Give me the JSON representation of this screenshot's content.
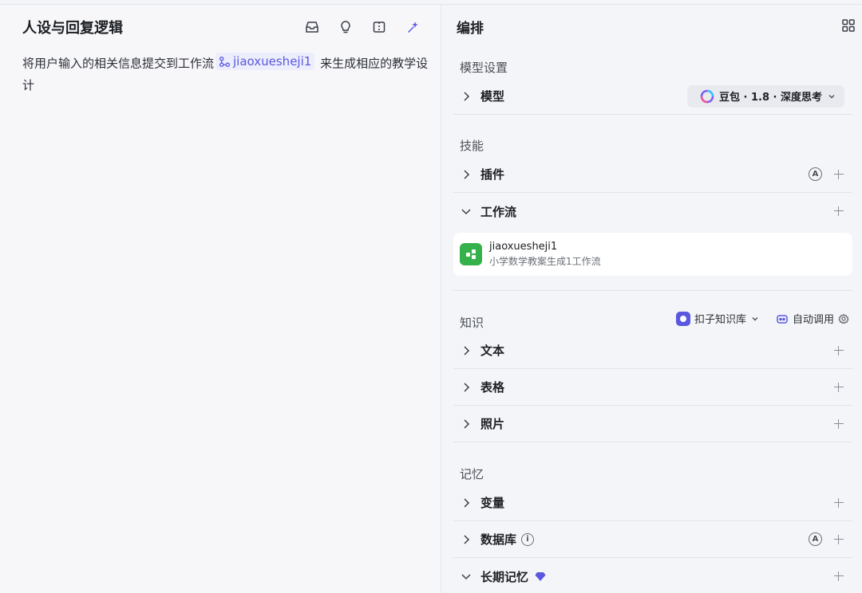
{
  "left": {
    "title": "人设与回复逻辑",
    "prompt_before": "将用户输入的相关信息提交到工作流",
    "workflow_ref": "jiaoxuesheji1",
    "prompt_after": " 来生成相应的教学设计"
  },
  "right": {
    "title": "编排",
    "model_section": "模型设置",
    "model_label": "模型",
    "model_value": "豆包 · 1.8 · 深度思考",
    "skills_section": "技能",
    "plugin_label": "插件",
    "workflow_label": "工作流",
    "workflow_card": {
      "name": "jiaoxuesheji1",
      "desc": "小学数学教案生成1工作流"
    },
    "knowledge_section": "知识",
    "kb_source": "扣子知识库",
    "kb_mode": "自动调用",
    "text_label": "文本",
    "table_label": "表格",
    "photo_label": "照片",
    "memory_section": "记忆",
    "variable_label": "变量",
    "database_label": "数据库",
    "longterm_label": "长期记忆"
  },
  "colors": {
    "accent": "#5a57e0",
    "workflow_green": "#34b14b",
    "background": "#f4f5f8"
  },
  "icons": [
    "inbox-icon",
    "lightbulb-icon",
    "split-view-icon",
    "magic-wand-icon",
    "grid-icon",
    "chevron-right-icon",
    "chevron-down-icon",
    "plus-icon",
    "auto-badge-icon",
    "info-icon",
    "gem-icon",
    "settings-icon"
  ]
}
